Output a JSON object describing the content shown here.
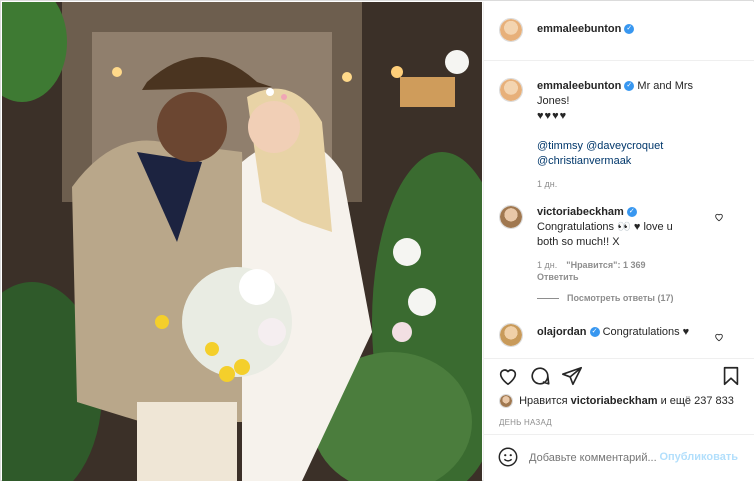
{
  "post": {
    "author": "emmaleebunton",
    "caption_line1": "Mr and Mrs",
    "caption_line2": "Jones!",
    "caption_hearts": "♥♥♥♥",
    "mention1": "@timmsy",
    "mention2": "@daveycroquet",
    "mention3": "@christianvermaak",
    "caption_time": "1 дн."
  },
  "comments": [
    {
      "user": "victoriabeckham",
      "text_line1": "Congratulations 👀 ♥ love u",
      "text_line2": "both so much!! X",
      "time": "1 дн.",
      "likes": "\"Нравится\": 1 369",
      "reply": "Ответить",
      "view_replies": "Посмотреть ответы (17)"
    },
    {
      "user": "olajordan",
      "text": "Congratulations ♥"
    }
  ],
  "likes_summary": {
    "prefix": "Нравится",
    "user": "victoriabeckham",
    "suffix": "и ещё 237 833"
  },
  "date_label": "ДЕНЬ НАЗАД",
  "comment_input": {
    "placeholder": "Добавьте комментарий...",
    "publish": "Опубликовать"
  },
  "icons": {
    "like": "heart-icon",
    "comment": "comment-icon",
    "share": "share-icon",
    "save": "bookmark-icon",
    "emoji": "emoji-icon",
    "verified": "verified-badge-icon"
  },
  "colors": {
    "verified": "#3897f0",
    "link": "#00376b",
    "muted": "#8e8e8e",
    "publish_disabled": "#b2dffc"
  }
}
